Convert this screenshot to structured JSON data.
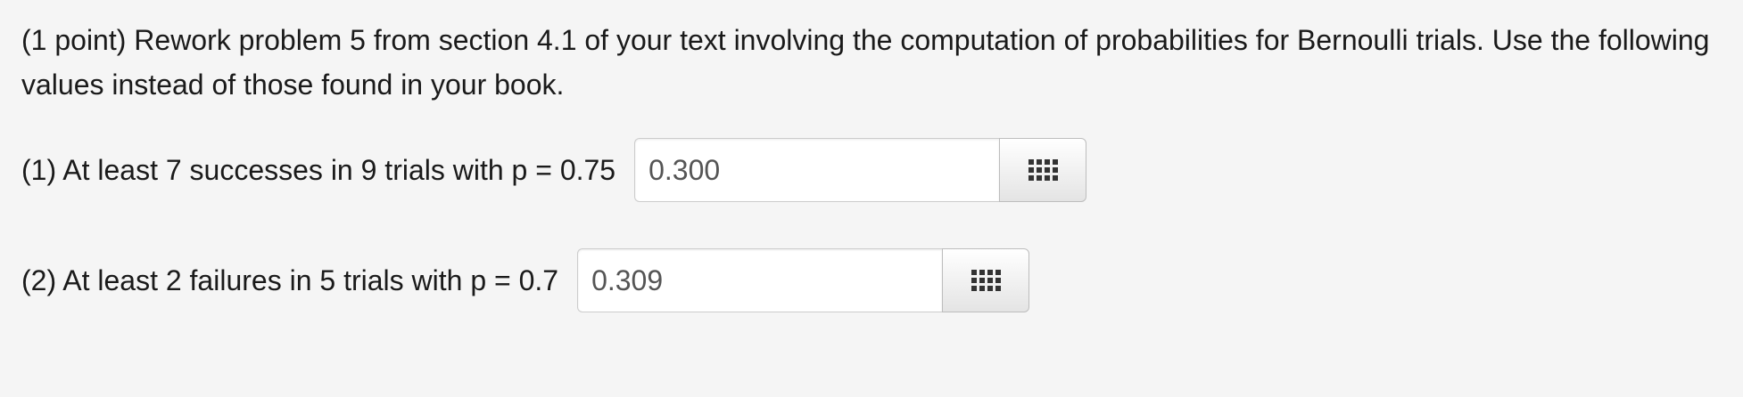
{
  "problem": {
    "intro_text": "(1 point) Rework problem 5 from section 4.1 of your text involving the computation of probabilities for Bernoulli trials. Use the following values instead of those found in your book."
  },
  "questions": [
    {
      "label": "(1) At least 7 successes in 9 trials with p = 0.75",
      "answer_value": "0.300",
      "palette_icon": "grid-icon"
    },
    {
      "label": "(2) At least 2 failures in 5 trials with p = 0.7",
      "answer_value": "0.309",
      "palette_icon": "grid-icon"
    }
  ],
  "colors": {
    "background": "#f5f5f5",
    "text": "#1a1a1a",
    "input_text": "#555555",
    "input_border": "#cccccc"
  }
}
